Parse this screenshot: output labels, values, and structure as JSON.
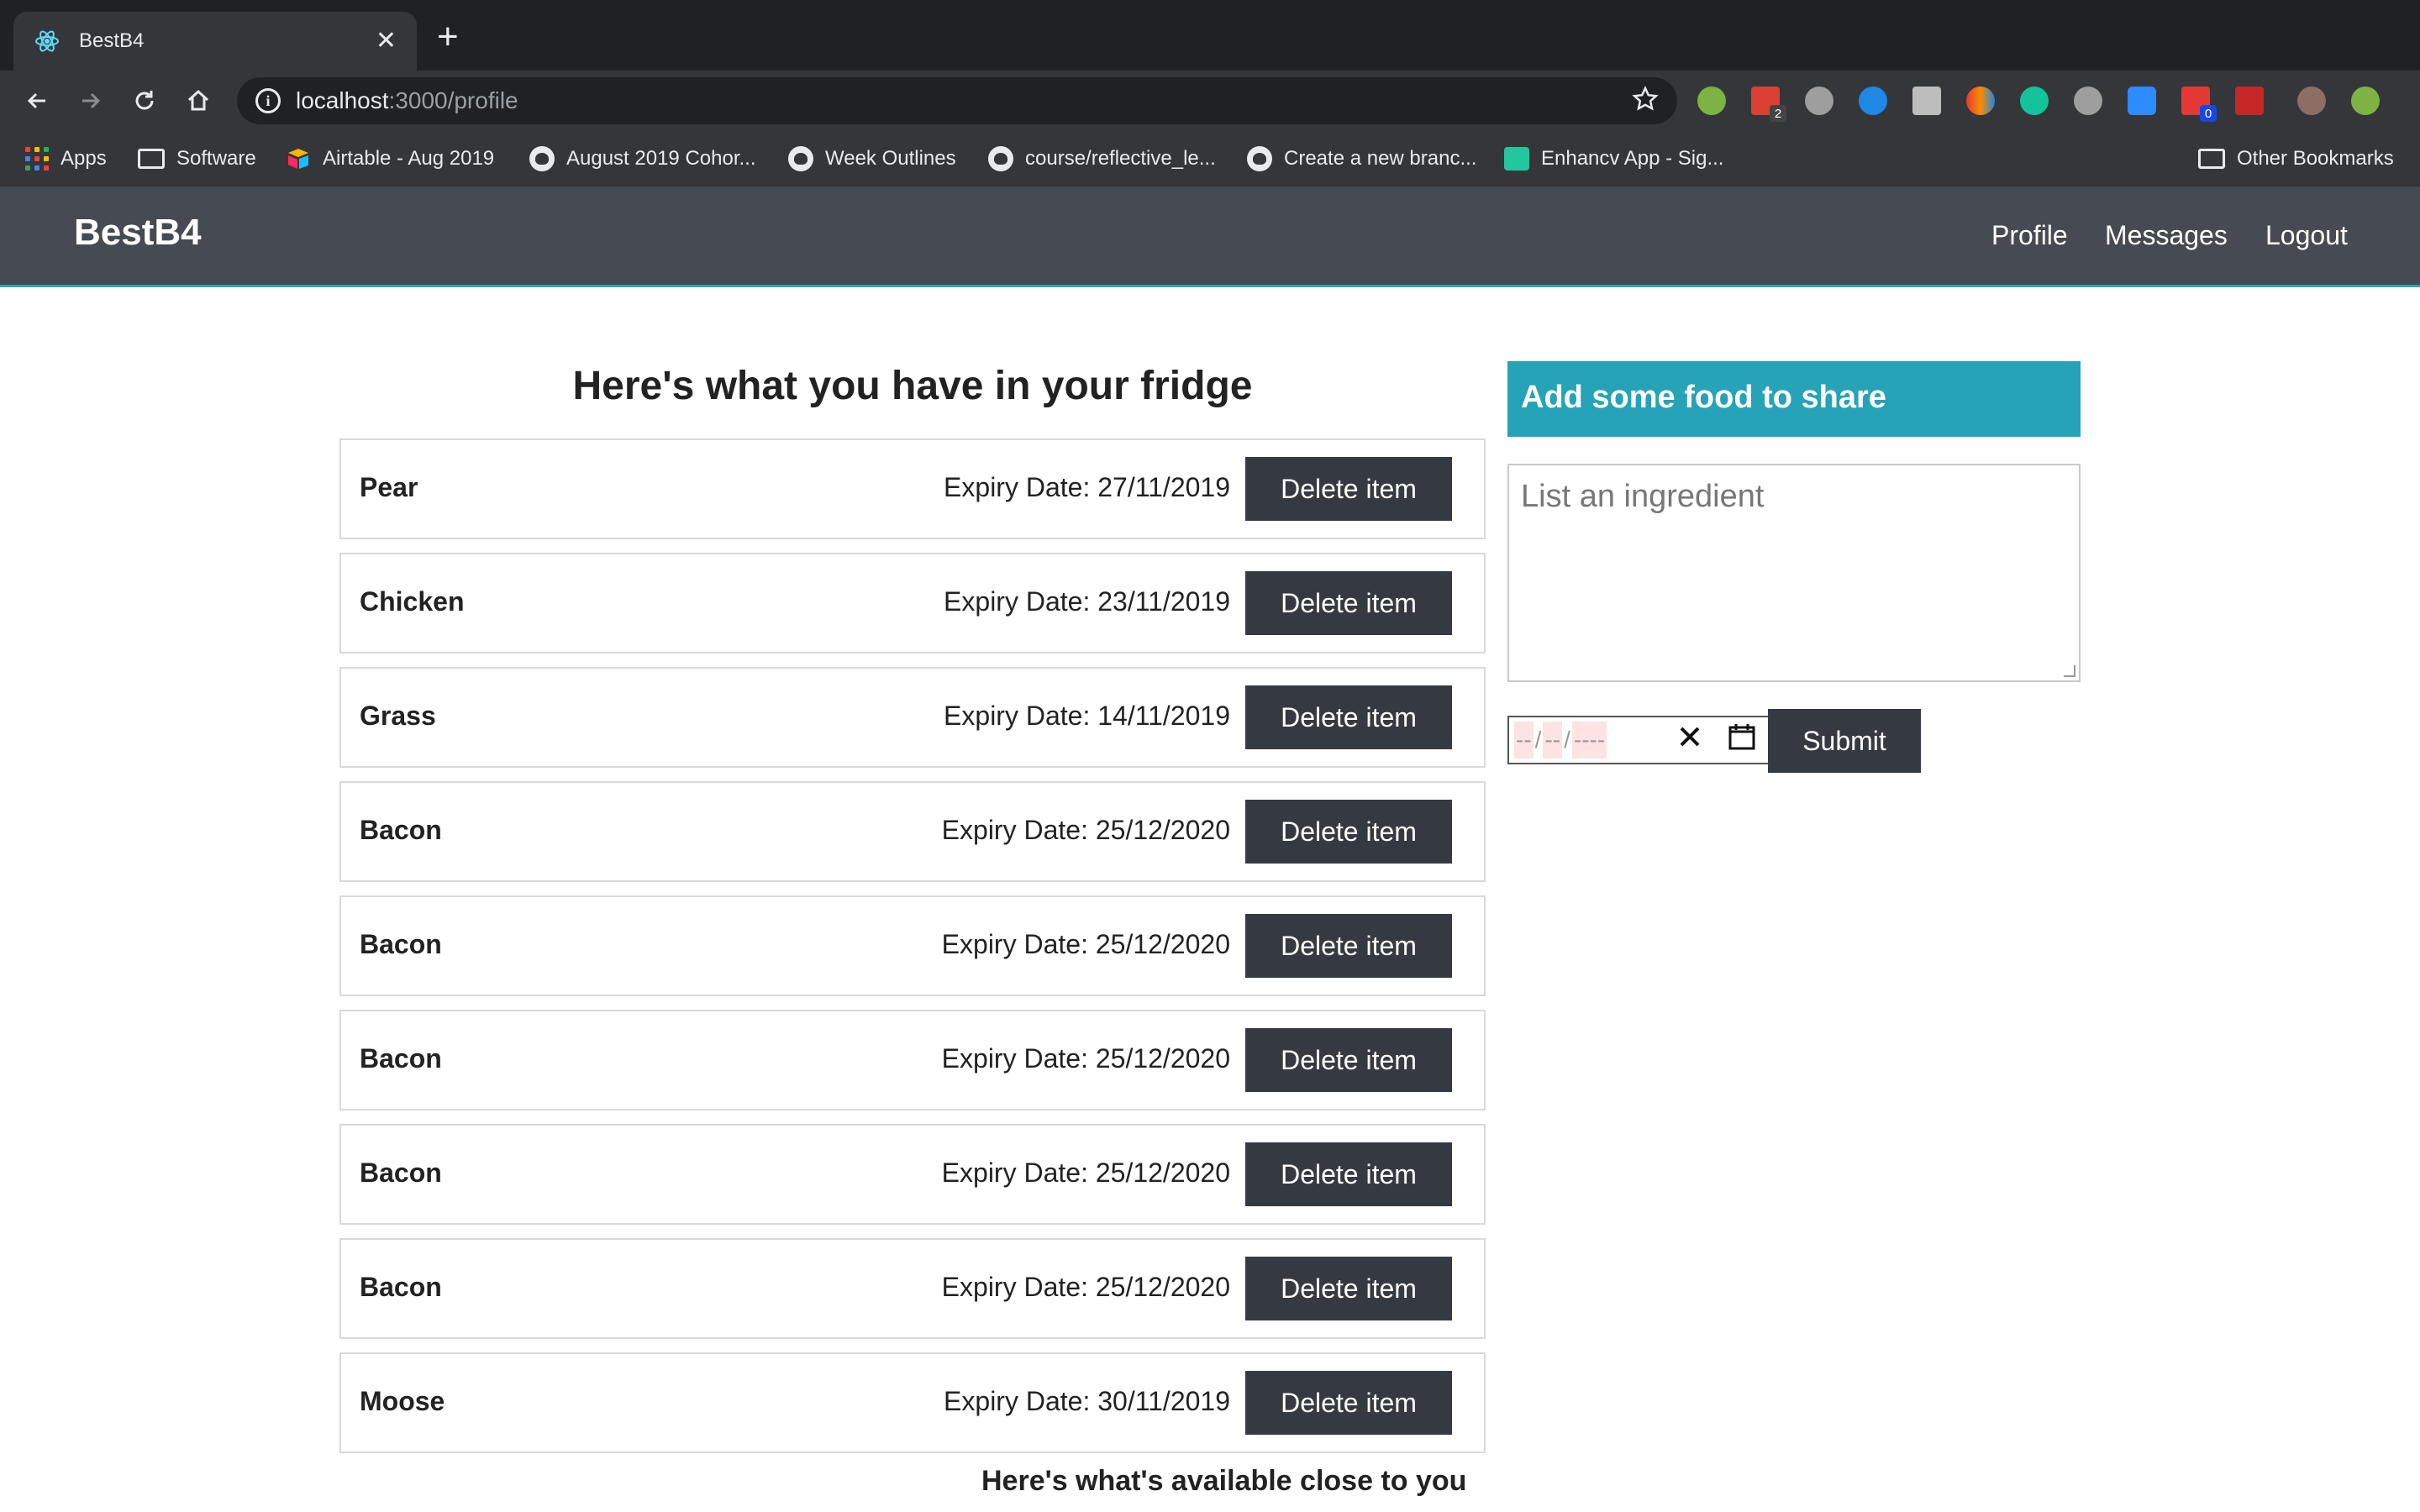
{
  "browser": {
    "tab_title": "BestB4",
    "url_host": "localhost",
    "url_path": ":3000/profile",
    "extension_badges": {
      "todoist": "2",
      "adblock": "0"
    },
    "bookmarks": [
      {
        "label": "Apps",
        "icon": "apps-grid-icon"
      },
      {
        "label": "Software",
        "icon": "folder-icon"
      },
      {
        "label": "Airtable - Aug 2019",
        "icon": "airtable-icon"
      },
      {
        "label": "August 2019 Cohor...",
        "icon": "github-icon"
      },
      {
        "label": "Week Outlines",
        "icon": "github-icon"
      },
      {
        "label": "course/reflective_le...",
        "icon": "github-icon"
      },
      {
        "label": "Create a new branc...",
        "icon": "github-icon"
      },
      {
        "label": "Enhancv App - Sig...",
        "icon": "enhancv-icon"
      }
    ],
    "other_bookmarks": "Other Bookmarks"
  },
  "navbar": {
    "brand": "BestB4",
    "links": [
      "Profile",
      "Messages",
      "Logout"
    ]
  },
  "fridge": {
    "title": "Here's what you have in your fridge",
    "expiry_prefix": "Expiry Date: ",
    "delete_label": "Delete item",
    "items": [
      {
        "name": "Pear",
        "expiry": "Expiry Date: 27/11/2019"
      },
      {
        "name": "Chicken",
        "expiry": "Expiry Date: 23/11/2019"
      },
      {
        "name": "Grass",
        "expiry": "Expiry Date: 14/11/2019"
      },
      {
        "name": "Bacon",
        "expiry": "Expiry Date: 25/12/2020"
      },
      {
        "name": "Bacon",
        "expiry": "Expiry Date: 25/12/2020"
      },
      {
        "name": "Bacon",
        "expiry": "Expiry Date: 25/12/2020"
      },
      {
        "name": "Bacon",
        "expiry": "Expiry Date: 25/12/2020"
      },
      {
        "name": "Bacon",
        "expiry": "Expiry Date: 25/12/2020"
      },
      {
        "name": "Moose",
        "expiry": "Expiry Date: 30/11/2019"
      }
    ],
    "nearby_title": "Here's what's available close to you"
  },
  "share": {
    "header": "Add some food to share",
    "ingredient_placeholder": "List an ingredient",
    "date_day": "--",
    "date_month": "--",
    "date_year": "----",
    "submit_label": "Submit"
  },
  "colors": {
    "navbar_bg": "#464a52",
    "accent_teal": "#26a3b7",
    "button_dark": "#353a42"
  }
}
